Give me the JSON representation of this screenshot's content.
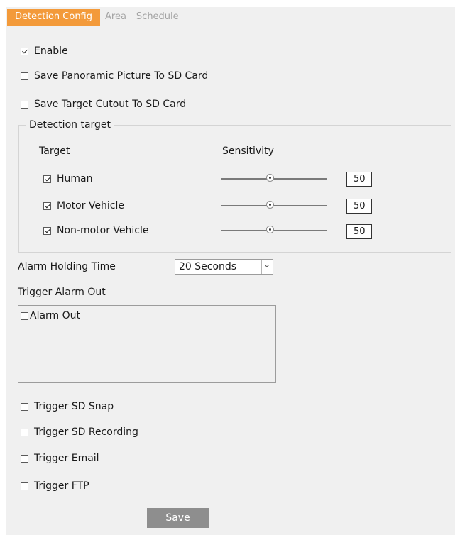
{
  "tabs": [
    {
      "label": "Detection Config",
      "active": true
    },
    {
      "label": "Area",
      "active": false
    },
    {
      "label": "Schedule",
      "active": false
    }
  ],
  "options": {
    "enable": {
      "label": "Enable",
      "checked": true
    },
    "save_panoramic": {
      "label": "Save Panoramic Picture To SD Card",
      "checked": false
    },
    "save_cutout": {
      "label": "Save Target Cutout To SD Card",
      "checked": false
    }
  },
  "detection_target": {
    "legend": "Detection target",
    "col_target": "Target",
    "col_sensitivity": "Sensitivity",
    "rows": [
      {
        "label": "Human",
        "checked": true,
        "sensitivity": "50"
      },
      {
        "label": "Motor Vehicle",
        "checked": true,
        "sensitivity": "50"
      },
      {
        "label": "Non-motor Vehicle",
        "checked": true,
        "sensitivity": "50"
      }
    ]
  },
  "alarm_holding": {
    "label": "Alarm Holding Time",
    "value": "20 Seconds"
  },
  "trigger_alarm_out": {
    "label": "Trigger Alarm Out",
    "items": [
      {
        "label": "Alarm Out",
        "checked": false
      }
    ]
  },
  "triggers": [
    {
      "label": "Trigger SD Snap",
      "checked": false
    },
    {
      "label": "Trigger SD Recording",
      "checked": false
    },
    {
      "label": "Trigger Email",
      "checked": false
    },
    {
      "label": "Trigger FTP",
      "checked": false
    }
  ],
  "save_label": "Save",
  "colors": {
    "accent": "#f39a3a",
    "panel": "#f0f0f0",
    "button": "#8e8e8e"
  }
}
